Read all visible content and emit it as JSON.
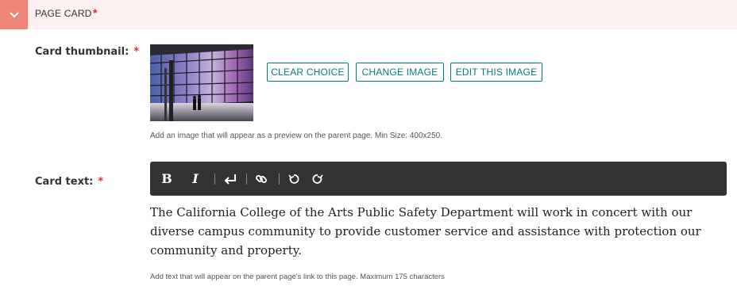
{
  "section": {
    "title": "PAGE CARD",
    "required_mark": "*"
  },
  "thumbnail": {
    "label": "Card thumbnail:",
    "required_mark": "*",
    "buttons": {
      "clear": "CLEAR CHOICE",
      "change": "CHANGE IMAGE",
      "edit": "EDIT THIS IMAGE"
    },
    "help": "Add an image that will appear as a preview on the parent page. Min Size: 400x250."
  },
  "card_text": {
    "label": "Card text:",
    "required_mark": "*",
    "toolbar": {
      "bold": "B",
      "italic": "I",
      "icons": [
        "return-icon",
        "link-icon",
        "undo-icon",
        "redo-icon"
      ]
    },
    "value": "The California College of the Arts Public Safety Department will work in concert with our diverse campus community to provide customer service and assistance with protection our community and property.",
    "help": "Add text that will appear on the parent page's link to this page. Maximum 175 characters"
  },
  "colors": {
    "header_bg": "#fdf0f0",
    "toggle_bg": "#f08479",
    "required": "#cd3238",
    "button": "#007d7e",
    "toolbar": "#333333"
  }
}
